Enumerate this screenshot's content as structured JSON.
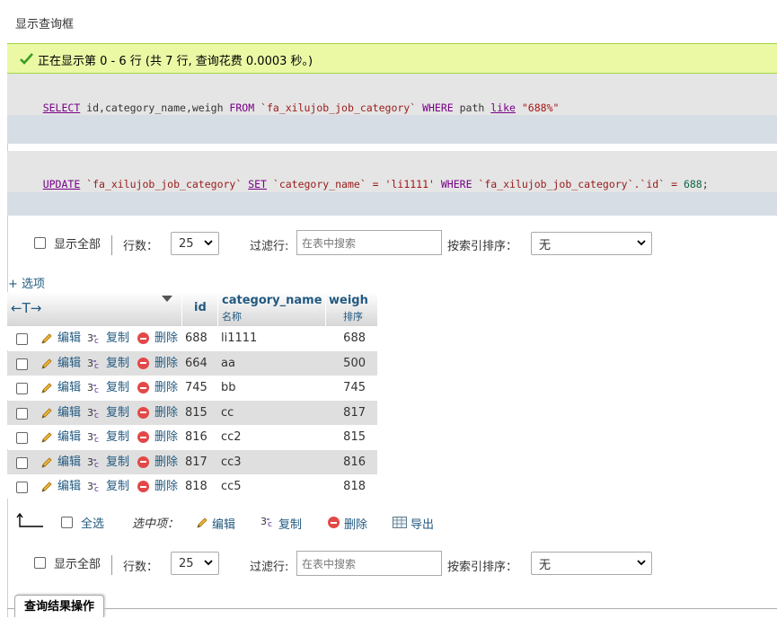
{
  "page": {
    "title": "显示查询框"
  },
  "success": {
    "message": "正在显示第 0 - 6 行 (共 7 行, 查询花费 0.0003 秒。)"
  },
  "sql1": {
    "t1": "SELECT",
    "t2": " id,category_name,weigh ",
    "t3": "FROM",
    "t4": " `fa_xilujob_job_category` ",
    "t5": "WHERE",
    "t6": " path ",
    "t7": "like",
    "t8": " ",
    "t9": "\"688%\""
  },
  "sql2": {
    "t1": "UPDATE",
    "t2": " `fa_xilujob_job_category` ",
    "t3": "SET",
    "t4": " `category_name` ",
    "t5": "=",
    "t6": " ",
    "t7": "'li1111'",
    "t8": " ",
    "t9": "WHERE",
    "t10": " `fa_xilujob_job_category`.`id` ",
    "t11": "=",
    "t12": " ",
    "t13": "688",
    "t14": ";"
  },
  "nav": {
    "show_all": "显示全部",
    "rows_label": "行数：",
    "rows_value": "25",
    "filter_label": "过滤行:",
    "filter_placeholder": "在表中搜索",
    "sort_label": "按索引排序：",
    "sort_value": "无"
  },
  "options_link": "+ 选项",
  "table": {
    "arrows": "←T→",
    "columns": [
      {
        "name": "id",
        "sub": ""
      },
      {
        "name": "category_name",
        "sub": "名称"
      },
      {
        "name": "weigh",
        "sub": "排序"
      }
    ],
    "actions": {
      "edit": "编辑",
      "copy": "复制",
      "delete": "删除"
    },
    "rows": [
      {
        "id": "688",
        "category_name": "li1111",
        "weigh": "688"
      },
      {
        "id": "664",
        "category_name": "aa",
        "weigh": "500"
      },
      {
        "id": "745",
        "category_name": "bb",
        "weigh": "745"
      },
      {
        "id": "815",
        "category_name": "cc",
        "weigh": "817"
      },
      {
        "id": "816",
        "category_name": "cc2",
        "weigh": "815"
      },
      {
        "id": "817",
        "category_name": "cc3",
        "weigh": "816"
      },
      {
        "id": "818",
        "category_name": "cc5",
        "weigh": "818"
      }
    ]
  },
  "bulk": {
    "select_all": "全选",
    "with_selected": "选中项：",
    "edit": "编辑",
    "copy": "复制",
    "delete": "删除",
    "export": "导出"
  },
  "footer": {
    "tab": "查询结果操作"
  },
  "colors": {
    "success_bg": "#ebf8a4",
    "sql_bg": "#e5e5e5",
    "sql_bar": "#d7dde5",
    "link": "#235a81",
    "keyword": "#770088"
  }
}
